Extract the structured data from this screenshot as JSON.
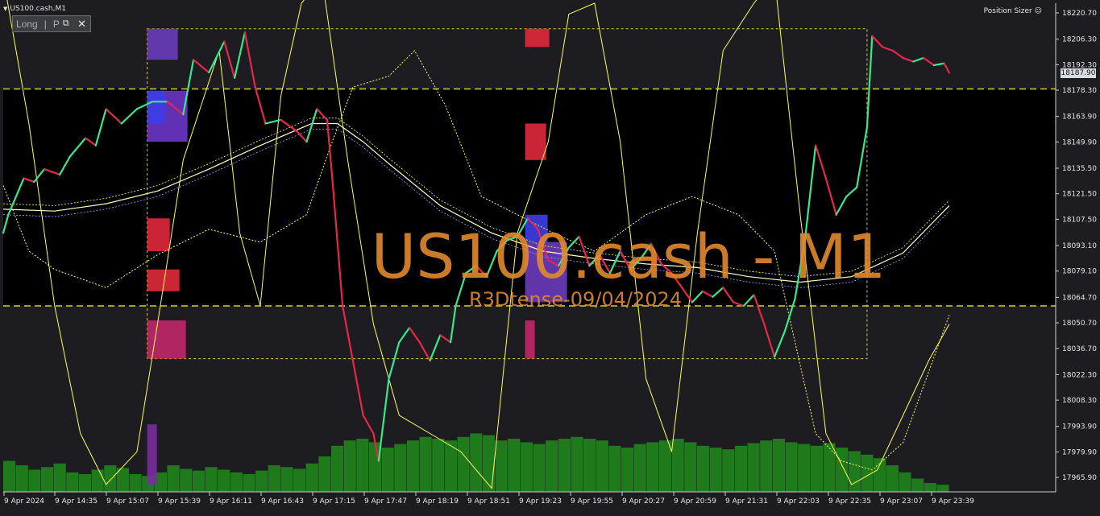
{
  "window": {
    "title": "US100.cash,M1",
    "position_sizer_label": "Position Sizer",
    "trade_panel": {
      "direction": "Long",
      "mode": "P",
      "close_label": "✕"
    }
  },
  "watermark": {
    "symbol_line": "US100.cash - M1",
    "sub_line": "R3Dtense-09/04/2024",
    "color": "#e38a2e"
  },
  "current_price_label": "18187.90",
  "colors": {
    "background": "#1d1d21",
    "box_fill": "#000000",
    "rising_line": "#38e88c",
    "falling_line": "#e8264a",
    "volume": "#1f7a1c",
    "bands": "#ffff4d",
    "levels": "#d9d226",
    "axis_text": "#e6e6e6"
  },
  "chart_data": {
    "type": "line",
    "title": "US100.cash - M1",
    "xlabel": "",
    "ylabel": "",
    "ylim": [
      17958,
      18226
    ],
    "grid": false,
    "x_ticks": [
      "9 Apr 2024",
      "9 Apr 14:35",
      "9 Apr 15:07",
      "9 Apr 15:39",
      "9 Apr 16:11",
      "9 Apr 16:43",
      "9 Apr 17:15",
      "9 Apr 17:47",
      "9 Apr 18:19",
      "9 Apr 18:51",
      "9 Apr 19:23",
      "9 Apr 19:55",
      "9 Apr 20:27",
      "9 Apr 20:59",
      "9 Apr 21:31",
      "9 Apr 22:03",
      "9 Apr 22:35",
      "9 Apr 23:07",
      "9 Apr 23:39"
    ],
    "y_ticks": [
      "18220.70",
      "18206.30",
      "18192.30",
      "18178.30",
      "18163.90",
      "18149.90",
      "18135.50",
      "18121.50",
      "18107.50",
      "18093.10",
      "18079.10",
      "18064.70",
      "18050.70",
      "18036.70",
      "18022.30",
      "18008.30",
      "17993.90",
      "17979.90",
      "17965.90"
    ],
    "price_path": [
      {
        "t": 0,
        "p": 18100
      },
      {
        "t": 2,
        "p": 18110
      },
      {
        "t": 5,
        "p": 18120
      },
      {
        "t": 8,
        "p": 18130
      },
      {
        "t": 12,
        "p": 18128
      },
      {
        "t": 16,
        "p": 18135
      },
      {
        "t": 22,
        "p": 18132
      },
      {
        "t": 26,
        "p": 18142
      },
      {
        "t": 32,
        "p": 18152
      },
      {
        "t": 36,
        "p": 18148
      },
      {
        "t": 40,
        "p": 18168
      },
      {
        "t": 46,
        "p": 18160
      },
      {
        "t": 52,
        "p": 18168
      },
      {
        "t": 58,
        "p": 18172
      },
      {
        "t": 64,
        "p": 18172
      },
      {
        "t": 70,
        "p": 18165
      },
      {
        "t": 74,
        "p": 18195
      },
      {
        "t": 80,
        "p": 18188
      },
      {
        "t": 86,
        "p": 18205
      },
      {
        "t": 90,
        "p": 18185
      },
      {
        "t": 94,
        "p": 18210
      },
      {
        "t": 98,
        "p": 18180
      },
      {
        "t": 102,
        "p": 18160
      },
      {
        "t": 108,
        "p": 18162
      },
      {
        "t": 114,
        "p": 18156
      },
      {
        "t": 118,
        "p": 18150
      },
      {
        "t": 122,
        "p": 18168
      },
      {
        "t": 126,
        "p": 18162
      },
      {
        "t": 128,
        "p": 18130
      },
      {
        "t": 132,
        "p": 18060
      },
      {
        "t": 136,
        "p": 18030
      },
      {
        "t": 140,
        "p": 18000
      },
      {
        "t": 144,
        "p": 17990
      },
      {
        "t": 146,
        "p": 17975
      },
      {
        "t": 150,
        "p": 18020
      },
      {
        "t": 154,
        "p": 18040
      },
      {
        "t": 158,
        "p": 18048
      },
      {
        "t": 162,
        "p": 18040
      },
      {
        "t": 166,
        "p": 18030
      },
      {
        "t": 170,
        "p": 18044
      },
      {
        "t": 174,
        "p": 18040
      },
      {
        "t": 176,
        "p": 18060
      },
      {
        "t": 180,
        "p": 18078
      },
      {
        "t": 184,
        "p": 18082
      },
      {
        "t": 188,
        "p": 18076
      },
      {
        "t": 192,
        "p": 18090
      },
      {
        "t": 196,
        "p": 18096
      },
      {
        "t": 200,
        "p": 18098
      },
      {
        "t": 204,
        "p": 18108
      },
      {
        "t": 208,
        "p": 18102
      },
      {
        "t": 212,
        "p": 18085
      },
      {
        "t": 216,
        "p": 18082
      },
      {
        "t": 220,
        "p": 18092
      },
      {
        "t": 224,
        "p": 18098
      },
      {
        "t": 228,
        "p": 18082
      },
      {
        "t": 232,
        "p": 18088
      },
      {
        "t": 236,
        "p": 18078
      },
      {
        "t": 240,
        "p": 18090
      },
      {
        "t": 244,
        "p": 18080
      },
      {
        "t": 248,
        "p": 18086
      },
      {
        "t": 252,
        "p": 18094
      },
      {
        "t": 256,
        "p": 18083
      },
      {
        "t": 260,
        "p": 18078
      },
      {
        "t": 264,
        "p": 18070
      },
      {
        "t": 268,
        "p": 18062
      },
      {
        "t": 272,
        "p": 18068
      },
      {
        "t": 276,
        "p": 18065
      },
      {
        "t": 280,
        "p": 18070
      },
      {
        "t": 284,
        "p": 18062
      },
      {
        "t": 288,
        "p": 18060
      },
      {
        "t": 292,
        "p": 18066
      },
      {
        "t": 296,
        "p": 18050
      },
      {
        "t": 300,
        "p": 18032
      },
      {
        "t": 304,
        "p": 18046
      },
      {
        "t": 308,
        "p": 18064
      },
      {
        "t": 312,
        "p": 18098
      },
      {
        "t": 316,
        "p": 18148
      },
      {
        "t": 320,
        "p": 18130
      },
      {
        "t": 324,
        "p": 18110
      },
      {
        "t": 328,
        "p": 18120
      },
      {
        "t": 332,
        "p": 18125
      },
      {
        "t": 336,
        "p": 18158
      },
      {
        "t": 338,
        "p": 18208
      },
      {
        "t": 342,
        "p": 18202
      },
      {
        "t": 346,
        "p": 18200
      },
      {
        "t": 350,
        "p": 18196
      },
      {
        "t": 354,
        "p": 18194
      },
      {
        "t": 358,
        "p": 18196
      },
      {
        "t": 362,
        "p": 18192
      },
      {
        "t": 366,
        "p": 18193
      },
      {
        "t": 368,
        "p": 18187.9
      }
    ],
    "ma_path": [
      {
        "t": 0,
        "p": 18113
      },
      {
        "t": 20,
        "p": 18112
      },
      {
        "t": 40,
        "p": 18116
      },
      {
        "t": 60,
        "p": 18123
      },
      {
        "t": 80,
        "p": 18135
      },
      {
        "t": 100,
        "p": 18148
      },
      {
        "t": 120,
        "p": 18160
      },
      {
        "t": 130,
        "p": 18160
      },
      {
        "t": 140,
        "p": 18150
      },
      {
        "t": 150,
        "p": 18138
      },
      {
        "t": 170,
        "p": 18115
      },
      {
        "t": 190,
        "p": 18100
      },
      {
        "t": 210,
        "p": 18090
      },
      {
        "t": 230,
        "p": 18086
      },
      {
        "t": 250,
        "p": 18083
      },
      {
        "t": 270,
        "p": 18081
      },
      {
        "t": 290,
        "p": 18076
      },
      {
        "t": 310,
        "p": 18073
      },
      {
        "t": 330,
        "p": 18076
      },
      {
        "t": 350,
        "p": 18089
      },
      {
        "t": 368,
        "p": 18115
      }
    ],
    "volume": [
      0.35,
      0.3,
      0.25,
      0.28,
      0.32,
      0.22,
      0.2,
      0.25,
      0.3,
      0.27,
      0.2,
      0.18,
      0.22,
      0.3,
      0.26,
      0.24,
      0.28,
      0.25,
      0.22,
      0.2,
      0.24,
      0.3,
      0.28,
      0.26,
      0.32,
      0.4,
      0.52,
      0.58,
      0.6,
      0.56,
      0.5,
      0.54,
      0.58,
      0.62,
      0.6,
      0.58,
      0.62,
      0.66,
      0.64,
      0.58,
      0.6,
      0.56,
      0.54,
      0.58,
      0.6,
      0.62,
      0.6,
      0.58,
      0.52,
      0.5,
      0.54,
      0.56,
      0.58,
      0.6,
      0.56,
      0.52,
      0.5,
      0.48,
      0.52,
      0.55,
      0.58,
      0.6,
      0.56,
      0.54,
      0.52,
      0.55,
      0.5,
      0.46,
      0.42,
      0.38,
      0.3,
      0.22,
      0.15,
      0.1,
      0.08
    ],
    "levels": {
      "upper": 18179,
      "lower": 18060
    },
    "boxes": [
      {
        "t0": 56,
        "t1": 336,
        "top": 18212,
        "bottom": 18031
      }
    ],
    "band_colors": "#ffff4d"
  }
}
